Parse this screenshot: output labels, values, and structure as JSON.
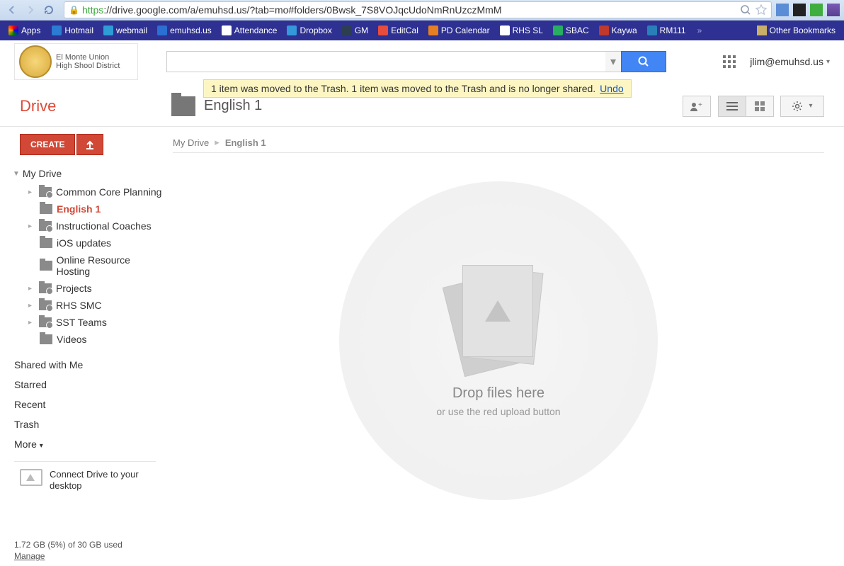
{
  "url": {
    "scheme": "https",
    "rest": "://drive.google.com/a/emuhsd.us/?tab=mo#folders/0Bwsk_7S8VOJqcUdoNmRnUzczMmM"
  },
  "bookmarks": {
    "apps": "Apps",
    "items": [
      "Hotmail",
      "webmail",
      "emuhsd.us",
      "Attendance",
      "Dropbox",
      "GM",
      "EditCal",
      "PD Calendar",
      "RHS SL",
      "SBAC",
      "Kaywa",
      "RM111"
    ],
    "other": "Other Bookmarks"
  },
  "district": {
    "line1": "El Monte Union",
    "line2": "High Shool District"
  },
  "account": "jlim@emuhsd.us",
  "notice": {
    "text": "1 item was moved to the Trash. 1 item was moved to the Trash and is no longer shared.",
    "undo": "Undo"
  },
  "drive_label": "Drive",
  "folder_title": "English 1",
  "breadcrumb": {
    "root": "My Drive",
    "current": "English 1"
  },
  "sidebar": {
    "create": "CREATE",
    "root": "My Drive",
    "folders": [
      {
        "label": "Common Core Planning",
        "shared": true,
        "expand": true
      },
      {
        "label": "English 1",
        "shared": false,
        "expand": false,
        "selected": true
      },
      {
        "label": "Instructional Coaches",
        "shared": true,
        "expand": true
      },
      {
        "label": "iOS updates",
        "shared": false,
        "expand": false
      },
      {
        "label": "Online Resource Hosting",
        "shared": false,
        "expand": false
      },
      {
        "label": "Projects",
        "shared": true,
        "expand": true
      },
      {
        "label": "RHS SMC",
        "shared": true,
        "expand": true
      },
      {
        "label": "SST Teams",
        "shared": true,
        "expand": true
      },
      {
        "label": "Videos",
        "shared": false,
        "expand": false
      }
    ],
    "links": [
      "Shared with Me",
      "Starred",
      "Recent",
      "Trash",
      "More"
    ],
    "connect": "Connect Drive to your desktop"
  },
  "dropzone": {
    "title": "Drop files here",
    "sub": "or use the red upload button"
  },
  "footer": {
    "usage": "1.72 GB (5%) of 30 GB used",
    "manage": "Manage"
  }
}
